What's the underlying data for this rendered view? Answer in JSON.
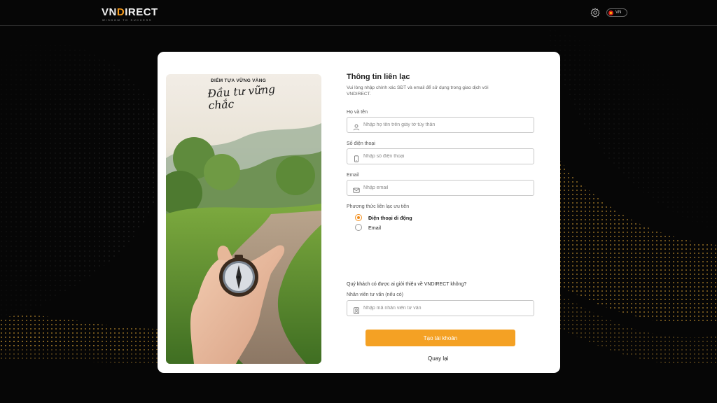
{
  "brand": {
    "name_pre": "VN",
    "name_accent": "D",
    "name_post": "IRECT",
    "tagline": "WISDOM TO SUCCESS",
    "accent_color": "#f59a1b"
  },
  "header": {
    "settings_icon": "gear-icon",
    "language": "VN"
  },
  "hero": {
    "kicker": "ĐIỂM TỰA VỮNG VÀNG",
    "script": "Đầu tư vững chắc"
  },
  "form": {
    "title": "Thông tin liên lạc",
    "description": "Vui lòng nhập chính xác SĐT và email để sử dụng trong giao dịch với VNDIRECT.",
    "full_name": {
      "label": "Họ và tên",
      "placeholder": "Nhập họ tên trên giấy tờ tùy thân",
      "icon": "user-icon"
    },
    "phone": {
      "label": "Số điện thoại",
      "placeholder": "Nhập số điện thoại",
      "icon": "phone-icon"
    },
    "email": {
      "label": "Email",
      "placeholder": "Nhập email",
      "icon": "mail-icon"
    },
    "contact_preference": {
      "label": "Phương thức liên lạc ưu tiên",
      "options": [
        {
          "label": "Điện thoại di động",
          "selected": true
        },
        {
          "label": "Email",
          "selected": false
        }
      ]
    },
    "referral": {
      "question": "Quý khách có được ai giới thiệu về VNDIRECT không?",
      "label": "Nhân viên tư vấn (nếu có)",
      "placeholder": "Nhập mã nhân viên tư vấn",
      "icon": "id-badge-icon"
    },
    "submit_label": "Tạo tài khoản",
    "back_label": "Quay lại",
    "submit_color": "#f4a124"
  }
}
